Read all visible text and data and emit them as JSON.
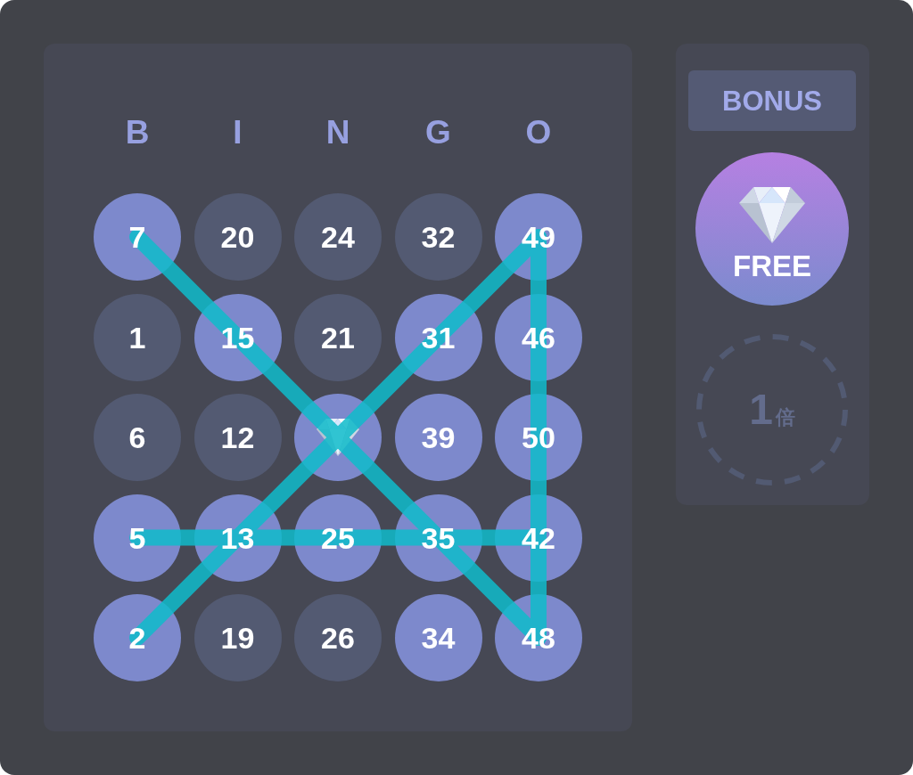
{
  "board": {
    "columns": [
      {
        "letter": "B",
        "line": false
      },
      {
        "letter": "I",
        "line": false
      },
      {
        "letter": "N",
        "line": false
      },
      {
        "letter": "G",
        "line": false
      },
      {
        "letter": "O",
        "line": true
      }
    ],
    "rows": [
      {
        "line": false,
        "cells": [
          {
            "kind": "number",
            "label": "7",
            "marked": true
          },
          {
            "kind": "number",
            "label": "20",
            "marked": false
          },
          {
            "kind": "number",
            "label": "24",
            "marked": false
          },
          {
            "kind": "number",
            "label": "32",
            "marked": false
          },
          {
            "kind": "number",
            "label": "49",
            "marked": true
          }
        ]
      },
      {
        "line": false,
        "cells": [
          {
            "kind": "number",
            "label": "1",
            "marked": false
          },
          {
            "kind": "number",
            "label": "15",
            "marked": true
          },
          {
            "kind": "number",
            "label": "21",
            "marked": false
          },
          {
            "kind": "number",
            "label": "31",
            "marked": true
          },
          {
            "kind": "number",
            "label": "46",
            "marked": true
          }
        ]
      },
      {
        "line": false,
        "cells": [
          {
            "kind": "number",
            "label": "6",
            "marked": false
          },
          {
            "kind": "number",
            "label": "12",
            "marked": false
          },
          {
            "kind": "gem",
            "marked": true
          },
          {
            "kind": "number",
            "label": "39",
            "marked": true
          },
          {
            "kind": "number",
            "label": "50",
            "marked": true
          }
        ]
      },
      {
        "line": true,
        "cells": [
          {
            "kind": "number",
            "label": "5",
            "marked": true
          },
          {
            "kind": "number",
            "label": "13",
            "marked": true
          },
          {
            "kind": "number",
            "label": "25",
            "marked": true
          },
          {
            "kind": "number",
            "label": "35",
            "marked": true
          },
          {
            "kind": "number",
            "label": "42",
            "marked": true
          }
        ]
      },
      {
        "line": false,
        "cells": [
          {
            "kind": "number",
            "label": "2",
            "marked": true
          },
          {
            "kind": "number",
            "label": "19",
            "marked": false
          },
          {
            "kind": "number",
            "label": "26",
            "marked": false
          },
          {
            "kind": "number",
            "label": "34",
            "marked": true
          },
          {
            "kind": "number",
            "label": "48",
            "marked": true
          }
        ]
      }
    ],
    "diagonals": {
      "down_line": true,
      "up_line": true
    }
  },
  "bonus": {
    "title": "BONUS",
    "free": {
      "label": "FREE"
    },
    "multiplier": {
      "value": "1",
      "unit": "倍",
      "active": false
    }
  }
}
